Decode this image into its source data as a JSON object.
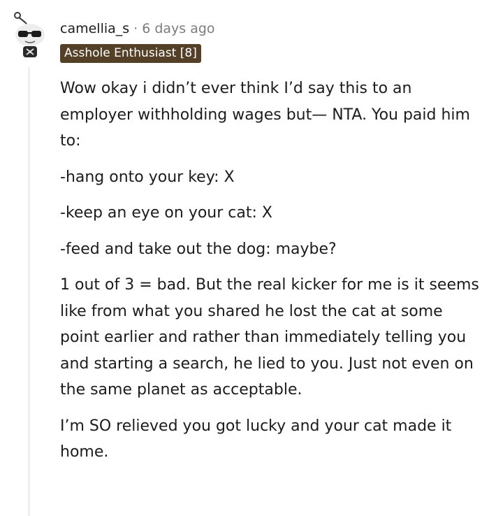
{
  "comment": {
    "username": "camellia_s",
    "separator": "·",
    "time": "6 days ago",
    "flair": "Asshole Enthusiast [8]",
    "avatar_icon": "snoo-sunglasses-avatar-icon",
    "paragraphs": [
      "Wow okay i didn’t ever think I’d say this to an employer withholding wages but— NTA. You paid him to:",
      "-hang onto your key: X",
      "-keep an eye on your cat: X",
      "-feed and take out the dog: maybe?",
      "1 out of 3 = bad. But the real kicker for me is it seems like from what you shared he lost the cat at some point earlier and rather than immediately telling you and starting a search, he lied to you. Just not even on the same planet as acceptable.",
      "I’m SO relieved you got lucky and your cat made it home."
    ]
  },
  "colors": {
    "flair_bg": "#544027",
    "flair_text": "#ffffff",
    "meta_text": "#7c7c7c",
    "body_text": "#1c1c1c",
    "thread_line": "#edeff1"
  }
}
